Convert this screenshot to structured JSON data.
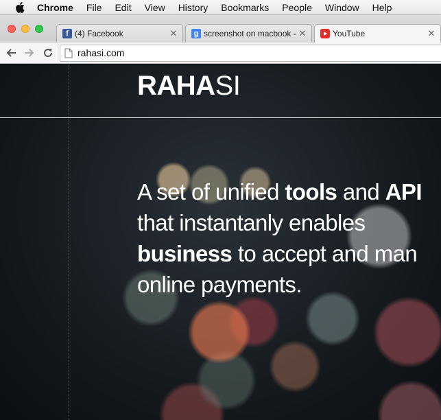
{
  "menubar": {
    "app_name": "Chrome",
    "items": [
      "File",
      "Edit",
      "View",
      "History",
      "Bookmarks",
      "People",
      "Window",
      "Help"
    ]
  },
  "tabs": [
    {
      "title": "(4) Facebook",
      "icon": "facebook-icon",
      "color": "#3b5998"
    },
    {
      "title": "screenshot on macbook -",
      "icon": "google-icon",
      "color": "#4285f4"
    },
    {
      "title": "YouTube",
      "icon": "youtube-icon",
      "color": "#e52d27"
    }
  ],
  "address_bar": {
    "url": "rahasi.com"
  },
  "page": {
    "logo_bold": "RAHA",
    "logo_light": "SI",
    "hero": {
      "l1a": "A set of unified ",
      "l1b": "tools",
      "l1c": " and ",
      "l1d": "API",
      "l2": "that instantanly enables",
      "l3a": "business",
      "l3b": " to accept and man",
      "l4": "online payments."
    }
  }
}
